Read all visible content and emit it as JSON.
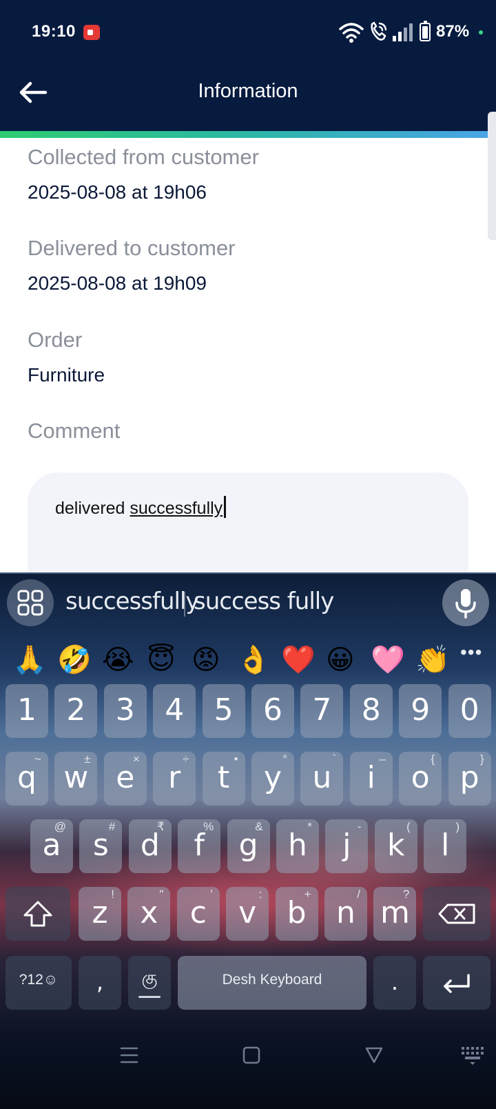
{
  "status_bar": {
    "time": "19:10",
    "battery": "87%",
    "icons": [
      "screen-record-icon",
      "wifi-icon",
      "wifi-call-icon",
      "signal-icon",
      "battery-icon"
    ]
  },
  "header": {
    "title": "Information",
    "back_icon": "arrow-left-icon",
    "accent_gradient": [
      "#2ecc71",
      "#4aa3e8"
    ]
  },
  "fields": {
    "collected": {
      "label": "Collected from customer",
      "value": "2025-08-08 at 19h06"
    },
    "delivered": {
      "label": "Delivered to customer",
      "value": "2025-08-08 at 19h09"
    },
    "order": {
      "label": "Order",
      "value": "Furniture"
    },
    "comment": {
      "label": "Comment",
      "text_before": "delivered ",
      "text_underlined": "successfully"
    }
  },
  "keyboard": {
    "suggestions": [
      "successfully",
      "success fully"
    ],
    "emojis": [
      "🙏",
      "🤣",
      "😭",
      "😇",
      "😡",
      "👌",
      "❤️",
      "😀",
      "🩷",
      "👏"
    ],
    "number_row": [
      "1",
      "2",
      "3",
      "4",
      "5",
      "6",
      "7",
      "8",
      "9",
      "0"
    ],
    "row1": [
      {
        "k": "q",
        "a": "~"
      },
      {
        "k": "w",
        "a": "±"
      },
      {
        "k": "e",
        "a": "×"
      },
      {
        "k": "r",
        "a": "÷"
      },
      {
        "k": "t",
        "a": "•"
      },
      {
        "k": "y",
        "a": "°"
      },
      {
        "k": "u",
        "a": "`"
      },
      {
        "k": "i",
        "a": "–"
      },
      {
        "k": "o",
        "a": "{"
      },
      {
        "k": "p",
        "a": "}"
      }
    ],
    "row2": [
      {
        "k": "a",
        "a": "@"
      },
      {
        "k": "s",
        "a": "#"
      },
      {
        "k": "d",
        "a": "₹"
      },
      {
        "k": "f",
        "a": "%"
      },
      {
        "k": "g",
        "a": "&"
      },
      {
        "k": "h",
        "a": "*"
      },
      {
        "k": "j",
        "a": "-"
      },
      {
        "k": "k",
        "a": "("
      },
      {
        "k": "l",
        "a": ")"
      }
    ],
    "row3": [
      {
        "k": "z",
        "a": "!"
      },
      {
        "k": "x",
        "a": "\""
      },
      {
        "k": "c",
        "a": "'"
      },
      {
        "k": "v",
        "a": ":"
      },
      {
        "k": "b",
        "a": "+"
      },
      {
        "k": "n",
        "a": "/"
      },
      {
        "k": "m",
        "a": "?"
      }
    ],
    "symbols_key": "?12☺",
    "comma_key": ",",
    "language_key": "கு",
    "space_label": "Desh Keyboard",
    "period_key": ".",
    "enter_icon": "enter-icon",
    "shift_icon": "shift-icon",
    "backspace_icon": "backspace-icon"
  },
  "navigation": [
    "menu-icon",
    "home-icon",
    "back-triangle-icon",
    "keyboard-icon"
  ]
}
